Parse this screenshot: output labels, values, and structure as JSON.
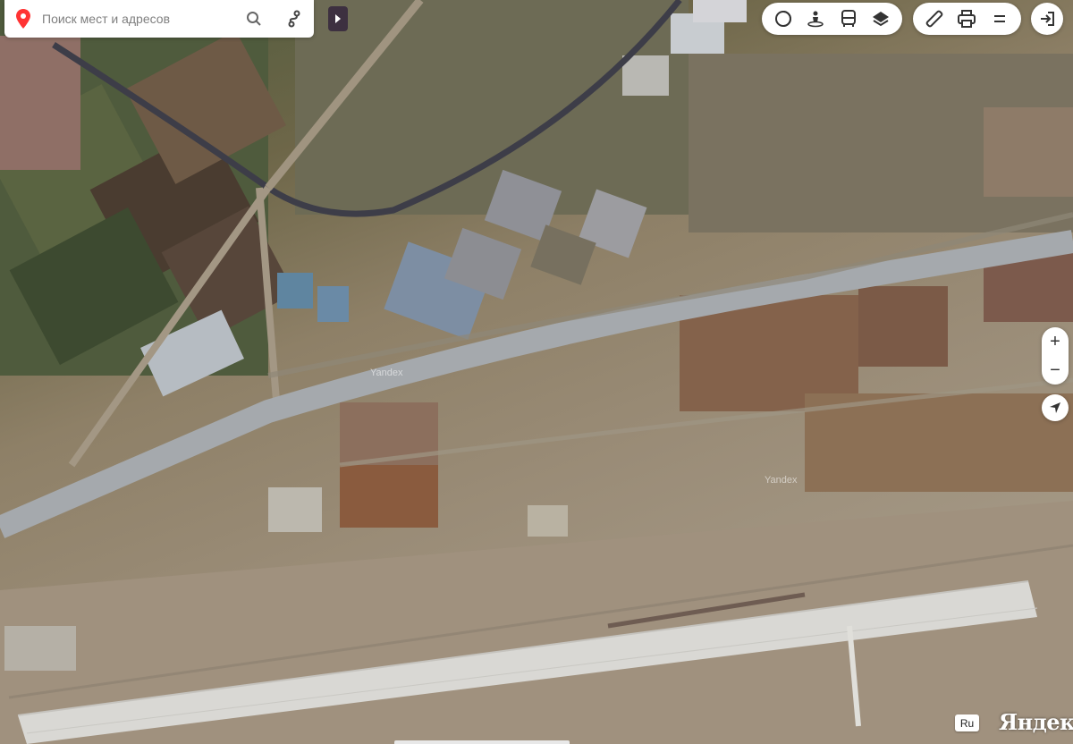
{
  "search": {
    "placeholder": "Поиск мест и адресов"
  },
  "map": {
    "watermark": "Yandex",
    "lang": "Ru",
    "logo": "Яндекс"
  },
  "toolbar_left": {
    "icons": [
      "panorama-icon",
      "street-view-icon",
      "transit-icon",
      "layers-icon"
    ]
  },
  "toolbar_right": {
    "icons": [
      "ruler-icon",
      "print-icon",
      "menu-icon"
    ]
  },
  "zoom": {
    "in_label": "+",
    "out_label": "−"
  },
  "colors": {
    "pin": "#f33",
    "toolbar_bg": "#ffffff",
    "collapse_bg": "#3d3040"
  }
}
